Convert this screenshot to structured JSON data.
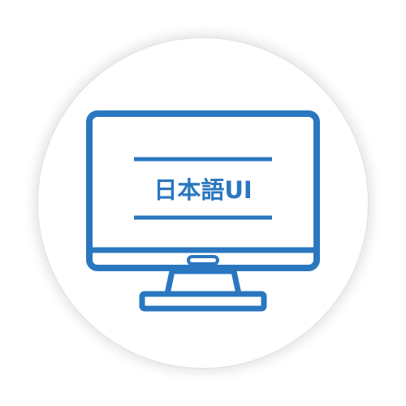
{
  "icon": {
    "name": "monitor-icon",
    "screen_text": "日本語UI",
    "color": "#2a77c0"
  }
}
